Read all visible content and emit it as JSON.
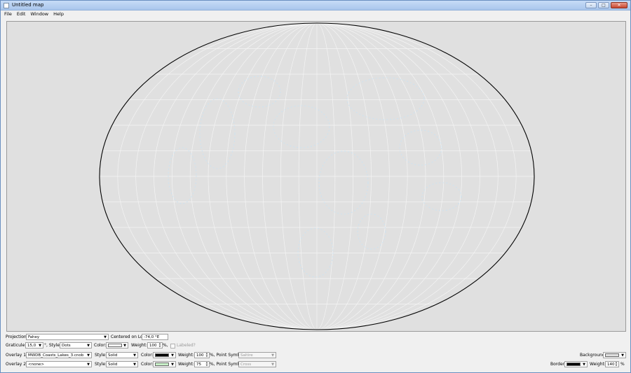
{
  "window": {
    "title": "Untitled map",
    "controls": [
      "–",
      "□",
      "✕"
    ]
  },
  "menu": [
    "File",
    "Edit",
    "Window",
    "Help"
  ],
  "map": {
    "background": "#e0e0e0",
    "border_color": "#000000",
    "graticule_color": "#f4f4f4",
    "coast_color": "#c7e3f5"
  },
  "projection": {
    "label": "Projection:",
    "value": "Fahey",
    "center_label": "Centered on Lon",
    "center_value": "-74,0 °E"
  },
  "graticule": {
    "label": "Graticule:",
    "spacing": "15,0",
    "deg_suffix": "°, Style:",
    "style": "Dots",
    "color_label": "Color:",
    "color": "#ffffff",
    "weight_label": "Weight:",
    "weight": "100",
    "pct": "%,",
    "labeled": "Labeled?"
  },
  "overlay1": {
    "label": "Overlay 1:",
    "file": "MWDB_Coasts_Lakes_3.cnob",
    "style_label": "Style:",
    "style": "Solid",
    "color_label": "Color:",
    "color": "#000000",
    "weight_label": "Weight:",
    "weight": "100",
    "pct": "%, Point Symbol",
    "symbol": "Saltire"
  },
  "overlay2": {
    "label": "Overlay 2:",
    "file": "<none>",
    "style_label": "Style:",
    "style": "Solid",
    "color_label": "Color:",
    "color": "#c8f0c8",
    "weight_label": "Weight:",
    "weight": "75",
    "pct": "%, Point Symbol",
    "symbol": "Cross"
  },
  "background": {
    "label": "Background:",
    "color": "#e0e0e0"
  },
  "border": {
    "label": "Border:",
    "color": "#000000",
    "weight_label": "Weight:",
    "weight": "140",
    "pct": "%"
  }
}
